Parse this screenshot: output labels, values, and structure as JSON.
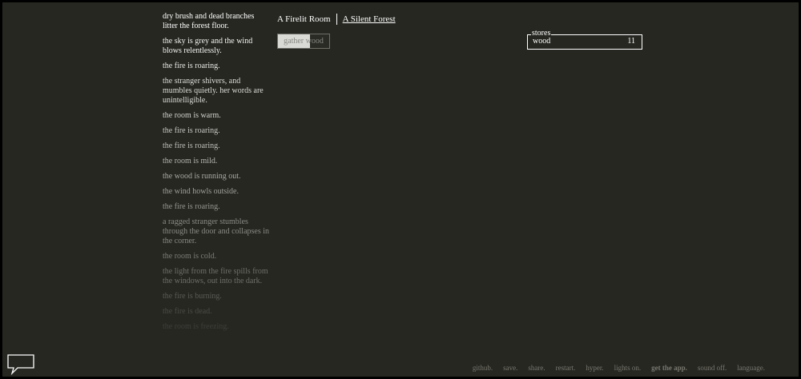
{
  "header": {
    "tabs": [
      {
        "label": "A Firelit Room",
        "active": true
      },
      {
        "label": "A Silent Forest",
        "active": false
      }
    ]
  },
  "notifications": [
    {
      "text": "dry brush and dead branches litter the forest floor.",
      "color": "#ffffff"
    },
    {
      "text": "the sky is grey and the wind blows relentlessly.",
      "color": "#f2f2f0"
    },
    {
      "text": "the fire is roaring.",
      "color": "#e8e8e5"
    },
    {
      "text": "the stranger shivers, and mumbles quietly. her words are unintelligible.",
      "color": "#dcdcd8"
    },
    {
      "text": "the room is warm.",
      "color": "#d2d2ce"
    },
    {
      "text": "the fire is roaring.",
      "color": "#c8c8c4"
    },
    {
      "text": "the fire is roaring.",
      "color": "#bebeba"
    },
    {
      "text": "the room is mild.",
      "color": "#b4b4b0"
    },
    {
      "text": "the wood is running out.",
      "color": "#aaaaa5"
    },
    {
      "text": "the wind howls outside.",
      "color": "#a0a09b"
    },
    {
      "text": "the fire is roaring.",
      "color": "#969691"
    },
    {
      "text": "a ragged stranger stumbles through the door and collapses in the corner.",
      "color": "#8a8a85"
    },
    {
      "text": "the room is cold.",
      "color": "#7d7d78"
    },
    {
      "text": "the light from the fire spills from the windows, out into the dark.",
      "color": "#6f6f6a"
    },
    {
      "text": "the fire is burning.",
      "color": "#5a5a55"
    },
    {
      "text": "the fire is dead.",
      "color": "#4b4b46"
    },
    {
      "text": "the room is freezing.",
      "color": "#3e3e3a"
    }
  ],
  "actions": {
    "gather_label": "gather wood",
    "gather_cooldown_fraction": 0.62
  },
  "stores": {
    "legend": "stores",
    "items": [
      {
        "name": "wood",
        "value": "11"
      }
    ]
  },
  "menu": {
    "items": [
      {
        "label": "github.",
        "bold": false
      },
      {
        "label": "save.",
        "bold": false
      },
      {
        "label": "share.",
        "bold": false
      },
      {
        "label": "restart.",
        "bold": false
      },
      {
        "label": "hyper.",
        "bold": false
      },
      {
        "label": "lights on.",
        "bold": false
      },
      {
        "label": "get the app.",
        "bold": true
      },
      {
        "label": "sound off.",
        "bold": false
      },
      {
        "label": "language.",
        "bold": false
      }
    ]
  },
  "icons": {
    "chat": "speech-bubble-icon"
  },
  "colors": {
    "background": "#272722",
    "text": "#ffffff",
    "menu_text": "#77776f",
    "button_fill": "#d9d9d6"
  }
}
